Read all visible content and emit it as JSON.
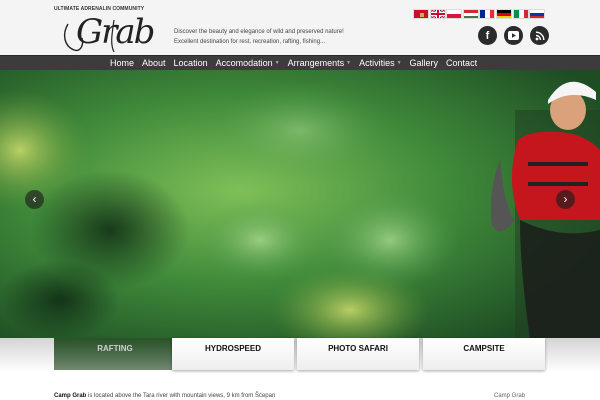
{
  "logo": {
    "top_text": "ULTIMATE ADRENALIN COMMUNITY",
    "word": "Grab"
  },
  "tagline": {
    "line1": "Discover the beauty and elegance of wild and preserved nature!",
    "line2": "Excellent destination for rest, recreation, rafting, fishing..."
  },
  "languages": [
    "Montenegrin",
    "English",
    "Polish",
    "Hungarian",
    "French",
    "German",
    "Italian",
    "Russian"
  ],
  "social": [
    {
      "name": "facebook",
      "glyph": "f"
    },
    {
      "name": "youtube",
      "glyph": "▶"
    },
    {
      "name": "rss",
      "glyph": "⌒"
    }
  ],
  "nav": [
    {
      "label": "Home",
      "dropdown": false
    },
    {
      "label": "About",
      "dropdown": false
    },
    {
      "label": "Location",
      "dropdown": false
    },
    {
      "label": "Accomodation",
      "dropdown": true
    },
    {
      "label": "Arrangements",
      "dropdown": true
    },
    {
      "label": "Activities",
      "dropdown": true
    },
    {
      "label": "Gallery",
      "dropdown": false
    },
    {
      "label": "Contact",
      "dropdown": false
    }
  ],
  "slider": {
    "prev": "‹",
    "next": "›"
  },
  "tabs": [
    {
      "label": "RAFTING",
      "active": true
    },
    {
      "label": "HYDROSPEED",
      "active": false
    },
    {
      "label": "PHOTO SAFARI",
      "active": false
    },
    {
      "label": "CAMPSITE",
      "active": false
    }
  ],
  "content": {
    "lead": "Camp Grab",
    "text": " is located above the Tara river with mountain views, 9 km from Šćepan",
    "right": "Camp Grab"
  },
  "colors": {
    "nav_bg": "#3c3c3c",
    "header_bg": "#f4f4f4",
    "water": "#3f8a3a"
  }
}
